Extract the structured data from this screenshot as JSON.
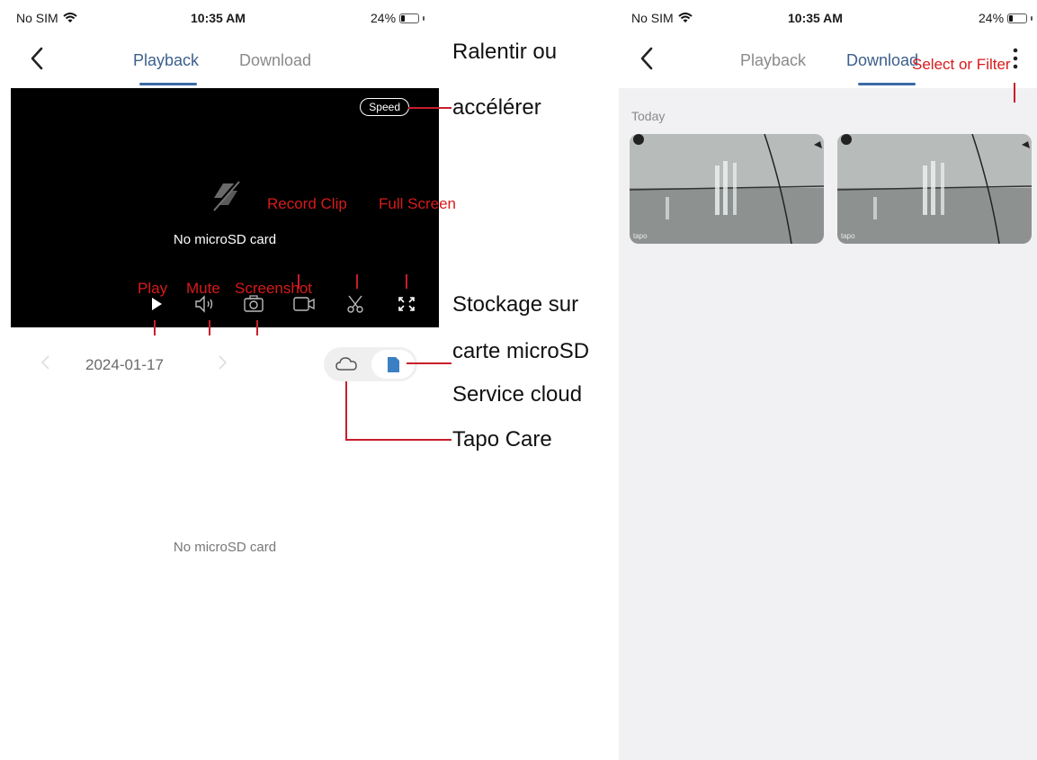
{
  "left": {
    "status": {
      "carrier": "No SIM",
      "time": "10:35 AM",
      "battery": "24%"
    },
    "tabs": [
      "Playback",
      "Download"
    ],
    "active_tab": "Playback",
    "video": {
      "speed_label": "Speed",
      "no_card_text": "No microSD card"
    },
    "date": "2024-01-17",
    "empty_text": "No microSD card"
  },
  "right": {
    "status": {
      "carrier": "No SIM",
      "time": "10:35 AM",
      "battery": "24%"
    },
    "tabs": [
      "Playback",
      "Download"
    ],
    "active_tab": "Download",
    "section_label": "Today",
    "thumb_watermark": "tapo"
  },
  "annotations": {
    "play": "Play",
    "mute": "Mute",
    "screenshot": "Screenshot",
    "record_clip": "Record Clip",
    "full_screen": "Full Screen",
    "select_filter": "Select or Filter"
  },
  "annotations_fr": {
    "speed_line1": "Ralentir ou",
    "speed_line2": "accélérer",
    "sd_line1": "Stockage sur",
    "sd_line2": "carte microSD",
    "cloud": "Service cloud",
    "care": "Tapo Care"
  },
  "battery_level": 0.24,
  "colors": {
    "accent": "#3c6aa6",
    "annotation_red": "#d81a1a",
    "video_bg": "#000000",
    "content_bg": "#f1f1f3"
  },
  "icons": [
    "wifi-icon",
    "back-chevron-icon",
    "no-sd-icon",
    "play-icon",
    "volume-icon",
    "camera-icon",
    "record-icon",
    "scissors-icon",
    "fullscreen-icon",
    "cloud-icon",
    "sd-card-icon",
    "more-icon"
  ]
}
